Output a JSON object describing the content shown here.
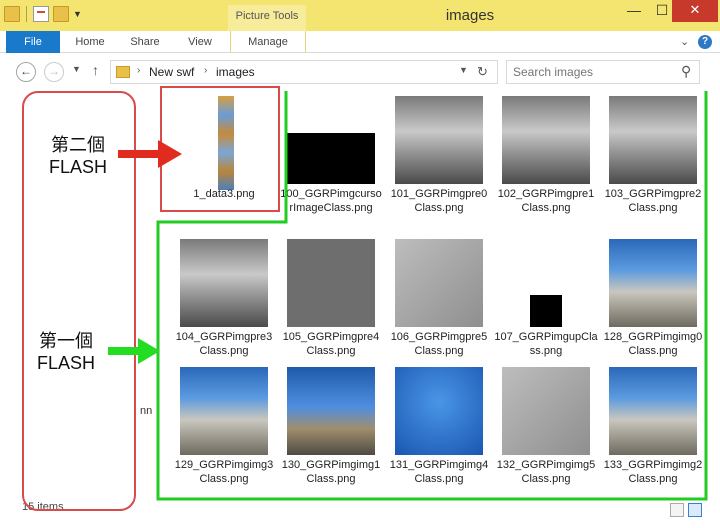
{
  "window": {
    "title": "images",
    "context_tab_group": "Picture Tools",
    "controls": {
      "minimize": "—",
      "maximize": "☐",
      "close": "✕"
    }
  },
  "ribbon": {
    "tabs": [
      "File",
      "Home",
      "Share",
      "View",
      "Manage"
    ]
  },
  "address": {
    "breadcrumb": [
      "New swf",
      "images"
    ],
    "search_placeholder": "Search images"
  },
  "files": [
    {
      "name": "1_data3.png",
      "kind": "strip"
    },
    {
      "name": "100_GGRPimgcursorImageClass.png",
      "kind": "black"
    },
    {
      "name": "101_GGRPimgpre0Class.png",
      "kind": "grey"
    },
    {
      "name": "102_GGRPimgpre1Class.png",
      "kind": "grey"
    },
    {
      "name": "103_GGRPimgpre2Class.png",
      "kind": "grey"
    },
    {
      "name": "104_GGRPimgpre3Class.png",
      "kind": "grey"
    },
    {
      "name": "105_GGRPimgpre4Class.png",
      "kind": "grey-flat"
    },
    {
      "name": "106_GGRPimgpre5Class.png",
      "kind": "grey-road"
    },
    {
      "name": "107_GGRPimgupClass.png",
      "kind": "black-small"
    },
    {
      "name": "128_GGRPimgimg0Class.png",
      "kind": "sky"
    },
    {
      "name": "129_GGRPimgimg3Class.png",
      "kind": "sky"
    },
    {
      "name": "130_GGRPimgimg1Class.png",
      "kind": "sky2"
    },
    {
      "name": "131_GGRPimgimg4Class.png",
      "kind": "blue"
    },
    {
      "name": "132_GGRPimgimg5Class.png",
      "kind": "grey-road"
    },
    {
      "name": "133_GGRPimgimg2Class.png",
      "kind": "sky"
    }
  ],
  "annotations": {
    "second_flash": "第二個\nFLASH",
    "first_flash": "第一個\nFLASH",
    "colors": {
      "red": "#d94a4a",
      "green": "#22cc22"
    }
  },
  "remnants": {
    "nav_pane": "nn",
    "status": "15 items"
  },
  "icons": [
    "folder-icon",
    "back-arrow-icon",
    "forward-arrow-icon",
    "up-arrow-icon",
    "refresh-icon",
    "search-icon",
    "help-icon"
  ]
}
